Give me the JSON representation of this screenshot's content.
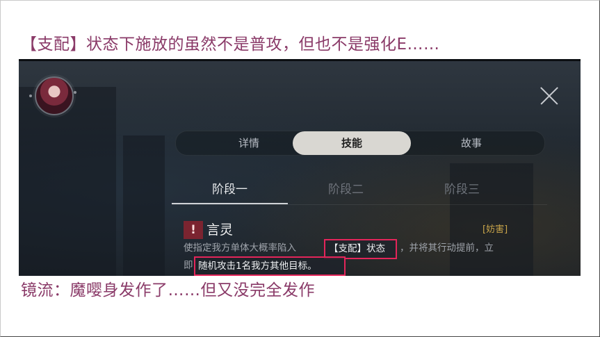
{
  "captions": {
    "top": "【支配】状态下施放的虽然不是普攻，但也不是强化E……",
    "bottom": "镜流：魔嘤身发作了……但又没完全发作"
  },
  "game": {
    "tabs": [
      {
        "label": "详情",
        "active": false
      },
      {
        "label": "技能",
        "active": true
      },
      {
        "label": "故事",
        "active": false
      }
    ],
    "stages": [
      {
        "label": "阶段一",
        "active": true
      },
      {
        "label": "阶段二",
        "active": false
      },
      {
        "label": "阶段三",
        "active": false
      }
    ],
    "skill": {
      "icon": "!",
      "name": "言灵",
      "tag": "[妨害]",
      "desc_line1_a": "使指定我方单体大概率陷入",
      "desc_hl1": "【支配】状态",
      "desc_line1_b": "，并将其行动提前，立",
      "desc_line2_a": "即",
      "desc_hl2": "随机攻击1名我方其他目标。"
    }
  },
  "colors": {
    "caption": "#8a3a68",
    "highlight_border": "#e4255a",
    "tag": "#c9a54a"
  }
}
